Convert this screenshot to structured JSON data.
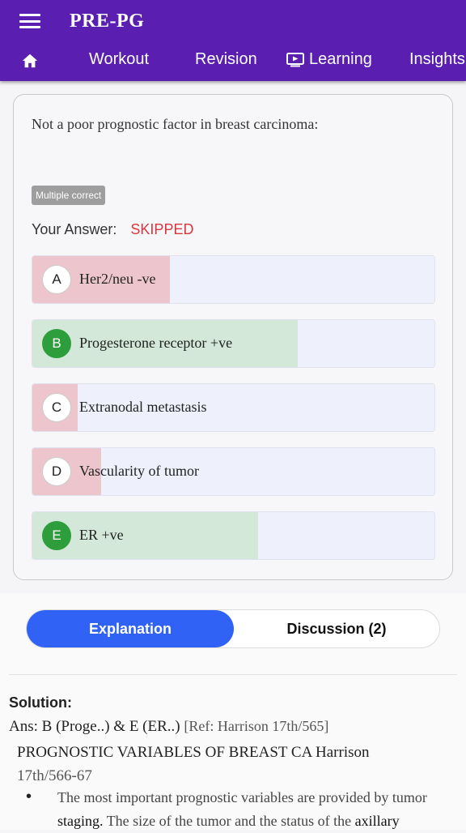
{
  "app": {
    "title": "PRE-PG"
  },
  "nav": {
    "items": [
      {
        "label": "Workout"
      },
      {
        "label": "Revision"
      },
      {
        "label": "Learning"
      },
      {
        "label": "Insights"
      }
    ]
  },
  "question": {
    "text": "Not a poor prognostic factor in breast carcinoma:",
    "badge": "Multiple correct",
    "your_answer_label": "Your Answer:",
    "your_answer_value": "SKIPPED",
    "options": [
      {
        "letter": "A",
        "text": "Her2/neu -ve",
        "correct": false
      },
      {
        "letter": "B",
        "text": "Progesterone receptor +ve",
        "correct": true
      },
      {
        "letter": "C",
        "text": "Extranodal metastasis",
        "correct": false
      },
      {
        "letter": "D",
        "text": "Vascularity of tumor",
        "correct": false
      },
      {
        "letter": "E",
        "text": "ER +ve",
        "correct": true
      }
    ]
  },
  "tabs": {
    "explanation": "Explanation",
    "discussion": "Discussion (2)"
  },
  "solution": {
    "heading": "Solution:",
    "ans": "Ans: B (Proge..) & E (ER..)",
    "ref": "[Ref: Harrison 17th/565]",
    "variables": "PROGNOSTIC VARIABLES OF BREAST CA Harrison",
    "variables_ref": "17th/566-67",
    "bullet_1_a": "The most important prognostic variables are provided by tumor",
    "bullet_1_b": "staging.",
    "bullet_1_c": "The size of the tumor and the status of the",
    "bullet_1_d": "axillary"
  },
  "colors": {
    "header": "#5a1fb0",
    "wrong": "#ecc6cc",
    "right": "#d3e8d8",
    "skipped": "#d9363e",
    "tab_active": "#2f62f5"
  },
  "icons": [
    "menu-icon",
    "home-icon",
    "learning-play-icon"
  ]
}
